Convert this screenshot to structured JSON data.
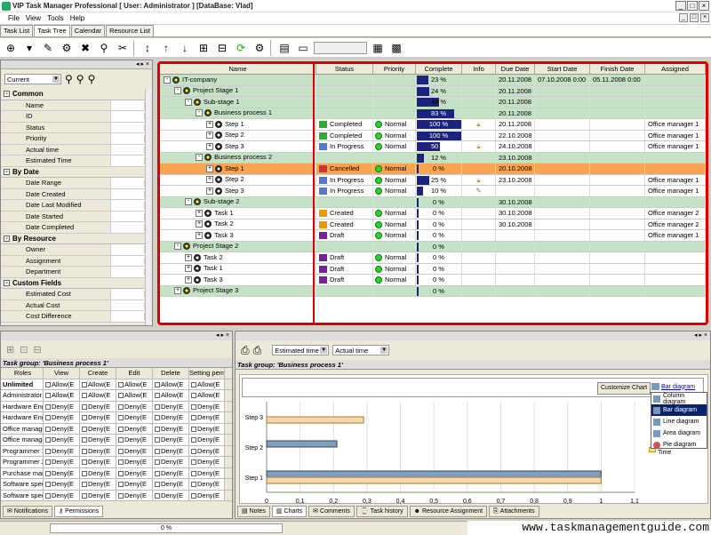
{
  "window": {
    "title": "VIP Task Manager Professional [ User: Administrator ] [DataBase: Vlad]"
  },
  "menu": [
    "File",
    "View",
    "Tools",
    "Help"
  ],
  "tabs": [
    "Task List",
    "Task Tree",
    "Calendar",
    "Resource List"
  ],
  "filter": {
    "combo": "Current",
    "groups": [
      {
        "title": "Common",
        "rows": [
          "Name",
          "ID",
          "Status",
          "Priority",
          "Actual time",
          "Estimated Time"
        ]
      },
      {
        "title": "By Date",
        "rows": [
          "Date Range",
          "Date Created",
          "Date Last Modified",
          "Date Started",
          "Date Completed"
        ]
      },
      {
        "title": "By Resource",
        "rows": [
          "Owner",
          "Assignment",
          "Department"
        ]
      },
      {
        "title": "Custom Fields",
        "rows": [
          "Estimated Cost",
          "Actual Cost",
          "Cost Difference"
        ]
      }
    ]
  },
  "grid": {
    "headers": [
      "Name",
      "Status",
      "Priority",
      "Complete",
      "Info",
      "Due Date",
      "Start Date",
      "Finish Date",
      "Assigned"
    ],
    "rows": [
      {
        "name": "IT-company",
        "indent": 0,
        "node": "-",
        "type": "proj",
        "status": "",
        "priority": "",
        "complete": "23 %",
        "pct": 0.23,
        "info": "",
        "due": "20.11.2008",
        "start": "07.10.2008 0:00",
        "finish": "05.11.2008 0:00",
        "assigned": "",
        "bg": "green"
      },
      {
        "name": "Project Stage 1",
        "indent": 1,
        "node": "-",
        "type": "proj",
        "status": "",
        "priority": "",
        "complete": "24 %",
        "pct": 0.24,
        "info": "",
        "due": "20.11.2008",
        "start": "",
        "finish": "",
        "assigned": "",
        "bg": "green"
      },
      {
        "name": "Sub-stage 1",
        "indent": 2,
        "node": "-",
        "type": "proj",
        "status": "",
        "priority": "",
        "complete": "48 %",
        "pct": 0.48,
        "info": "",
        "due": "20.11.2008",
        "start": "",
        "finish": "",
        "assigned": "",
        "bg": "green"
      },
      {
        "name": "Business process 1",
        "indent": 3,
        "node": "-",
        "type": "proj",
        "status": "",
        "priority": "",
        "complete": "83 %",
        "pct": 0.83,
        "info": "",
        "due": "20.11.2008",
        "start": "",
        "finish": "",
        "assigned": "",
        "bg": "hl"
      },
      {
        "name": "Step 1",
        "indent": 4,
        "node": "+",
        "type": "task",
        "status": "Completed",
        "priority": "Normal",
        "complete": "100 %",
        "pct": 1.0,
        "info": "lock",
        "due": "20.11.2008",
        "start": "",
        "finish": "",
        "assigned": "Office manager 1",
        "bg": ""
      },
      {
        "name": "Step 2",
        "indent": 4,
        "node": "+",
        "type": "task",
        "status": "Completed",
        "priority": "Normal",
        "complete": "100 %",
        "pct": 1.0,
        "info": "",
        "due": "22.10.2008",
        "start": "",
        "finish": "",
        "assigned": "Office manager 1",
        "bg": ""
      },
      {
        "name": "Step 3",
        "indent": 4,
        "node": "+",
        "type": "task",
        "status": "In Progress",
        "priority": "Normal",
        "complete": "50 %",
        "pct": 0.5,
        "info": "lock",
        "due": "24.10.2008",
        "start": "",
        "finish": "",
        "assigned": "Office manager 1",
        "bg": ""
      },
      {
        "name": "Business process 2",
        "indent": 3,
        "node": "-",
        "type": "proj",
        "status": "",
        "priority": "",
        "complete": "12 %",
        "pct": 0.12,
        "info": "",
        "due": "23.10.2008",
        "start": "",
        "finish": "",
        "assigned": "",
        "bg": "green"
      },
      {
        "name": "Step 1",
        "indent": 4,
        "node": "+",
        "type": "task",
        "status": "Cancelled",
        "priority": "Normal",
        "complete": "0 %",
        "pct": 0.0,
        "info": "",
        "due": "20.10.2008",
        "start": "",
        "finish": "",
        "assigned": "",
        "bg": "sel"
      },
      {
        "name": "Step 2",
        "indent": 4,
        "node": "+",
        "type": "task",
        "status": "In Progress",
        "priority": "Normal",
        "complete": "25 %",
        "pct": 0.25,
        "info": "lock",
        "due": "23.10.2008",
        "start": "",
        "finish": "",
        "assigned": "Office manager 1",
        "bg": ""
      },
      {
        "name": "Step 3",
        "indent": 4,
        "node": "+",
        "type": "task",
        "status": "In Progress",
        "priority": "Normal",
        "complete": "10 %",
        "pct": 0.1,
        "info": "note",
        "due": "",
        "start": "",
        "finish": "",
        "assigned": "Office manager 1",
        "bg": ""
      },
      {
        "name": "Sub-stage 2",
        "indent": 2,
        "node": "-",
        "type": "proj",
        "status": "",
        "priority": "",
        "complete": "0 %",
        "pct": 0.0,
        "info": "",
        "due": "30.10.2008",
        "start": "",
        "finish": "",
        "assigned": "",
        "bg": "green"
      },
      {
        "name": "Task 1",
        "indent": 3,
        "node": "+",
        "type": "task",
        "status": "Created",
        "priority": "Normal",
        "complete": "0 %",
        "pct": 0.0,
        "info": "",
        "due": "30.10.2008",
        "start": "",
        "finish": "",
        "assigned": "Office manager 2",
        "bg": ""
      },
      {
        "name": "Task 2",
        "indent": 3,
        "node": "+",
        "type": "task",
        "status": "Created",
        "priority": "Normal",
        "complete": "0 %",
        "pct": 0.0,
        "info": "",
        "due": "30.10.2008",
        "start": "",
        "finish": "",
        "assigned": "Office manager 2",
        "bg": ""
      },
      {
        "name": "Task 3",
        "indent": 3,
        "node": "+",
        "type": "task",
        "status": "Draft",
        "priority": "Normal",
        "complete": "0 %",
        "pct": 0.0,
        "info": "",
        "due": "",
        "start": "",
        "finish": "",
        "assigned": "Office manager 1",
        "bg": ""
      },
      {
        "name": "Project Stage 2",
        "indent": 1,
        "node": "-",
        "type": "proj",
        "status": "",
        "priority": "",
        "complete": "0 %",
        "pct": 0.0,
        "info": "",
        "due": "",
        "start": "",
        "finish": "",
        "assigned": "",
        "bg": "green"
      },
      {
        "name": "Task 2",
        "indent": 2,
        "node": "+",
        "type": "task",
        "status": "Draft",
        "priority": "Normal",
        "complete": "0 %",
        "pct": 0.0,
        "info": "",
        "due": "",
        "start": "",
        "finish": "",
        "assigned": "",
        "bg": ""
      },
      {
        "name": "Task 1",
        "indent": 2,
        "node": "+",
        "type": "task",
        "status": "Draft",
        "priority": "Normal",
        "complete": "0 %",
        "pct": 0.0,
        "info": "",
        "due": "",
        "start": "",
        "finish": "",
        "assigned": "",
        "bg": ""
      },
      {
        "name": "Task 3",
        "indent": 2,
        "node": "+",
        "type": "task",
        "status": "Draft",
        "priority": "Normal",
        "complete": "0 %",
        "pct": 0.0,
        "info": "",
        "due": "",
        "start": "",
        "finish": "",
        "assigned": "",
        "bg": ""
      },
      {
        "name": "Project Stage 3",
        "indent": 1,
        "node": "+",
        "type": "proj",
        "status": "",
        "priority": "",
        "complete": "0 %",
        "pct": 0.0,
        "info": "",
        "due": "",
        "start": "",
        "finish": "",
        "assigned": "",
        "bg": "green"
      }
    ]
  },
  "permissions": {
    "title": "Task group: 'Business process 1'",
    "headers": [
      "Roles",
      "View",
      "Create",
      "Edit",
      "Delete",
      "Setting pem"
    ],
    "rows": [
      {
        "role": "Unlimited",
        "bold": true,
        "v": "Allow(E",
        "c": "Allow(E",
        "e": "Allow(E",
        "d": "Allow(E",
        "s": "Allow(E"
      },
      {
        "role": "Administrator",
        "bold": false,
        "v": "Allow(E",
        "c": "Allow(E",
        "e": "Allow(E",
        "d": "Allow(E",
        "s": "Allow(E"
      },
      {
        "role": "Hardware Engi",
        "bold": false,
        "v": "Deny(E",
        "c": "Deny(E",
        "e": "Deny(E",
        "d": "Deny(E",
        "s": "Deny(E"
      },
      {
        "role": "Hardware Engi",
        "bold": false,
        "v": "Deny(E",
        "c": "Deny(E",
        "e": "Deny(E",
        "d": "Deny(E",
        "s": "Deny(E"
      },
      {
        "role": "Office manage",
        "bold": false,
        "v": "Deny(E",
        "c": "Deny(E",
        "e": "Deny(E",
        "d": "Deny(E",
        "s": "Deny(E"
      },
      {
        "role": "Office manage",
        "bold": false,
        "v": "Deny(E",
        "c": "Deny(E",
        "e": "Deny(E",
        "d": "Deny(E",
        "s": "Deny(E"
      },
      {
        "role": "Programmer 1",
        "bold": false,
        "v": "Deny(E",
        "c": "Deny(E",
        "e": "Deny(E",
        "d": "Deny(E",
        "s": "Deny(E"
      },
      {
        "role": "Programmer 2",
        "bold": false,
        "v": "Deny(E",
        "c": "Deny(E",
        "e": "Deny(E",
        "d": "Deny(E",
        "s": "Deny(E"
      },
      {
        "role": "Purchase man",
        "bold": false,
        "v": "Deny(E",
        "c": "Deny(E",
        "e": "Deny(E",
        "d": "Deny(E",
        "s": "Deny(E"
      },
      {
        "role": "Software speci",
        "bold": false,
        "v": "Deny(E",
        "c": "Deny(E",
        "e": "Deny(E",
        "d": "Deny(E",
        "s": "Deny(E"
      },
      {
        "role": "Software speci",
        "bold": false,
        "v": "Deny(E",
        "c": "Deny(E",
        "e": "Deny(E",
        "d": "Deny(E",
        "s": "Deny(E"
      }
    ],
    "tabs": [
      "Notifications",
      "Permissions"
    ]
  },
  "chartpanel": {
    "combo1": "Estimated time",
    "combo2": "Actual time",
    "title": "Task group: 'Business process 1'",
    "customize": "Customize Chart",
    "bar_diagram": "Bar diagram",
    "menu": [
      "Column diagram",
      "Bar diagram",
      "Line diagram",
      "Area diagram",
      "Pie diagram"
    ],
    "legend_partial": "Estimated Time",
    "tabs": [
      "Notes",
      "Charts",
      "Comments",
      "Task history",
      "Resource Assignment",
      "Attachments"
    ]
  },
  "chart_data": {
    "type": "bar",
    "orientation": "horizontal",
    "categories": [
      "Step 3",
      "Step 2",
      "Step 1"
    ],
    "series": [
      {
        "name": "Estimated Time",
        "values": [
          0.29,
          0.0,
          1.0
        ],
        "color": "#f7d8a8"
      },
      {
        "name": "",
        "values": [
          0.0,
          0.21,
          1.0
        ],
        "color": "#7f9fbf"
      }
    ],
    "xlim": [
      0,
      1.1
    ],
    "xticks": [
      "0",
      "0,1",
      "0,2",
      "0,3",
      "0,4",
      "0,5",
      "0,6",
      "0,7",
      "0,8",
      "0,9",
      "1",
      "1,1"
    ],
    "grid": true
  },
  "status": {
    "progress": "0 %"
  },
  "watermark": "www.taskmanagementguide.com"
}
